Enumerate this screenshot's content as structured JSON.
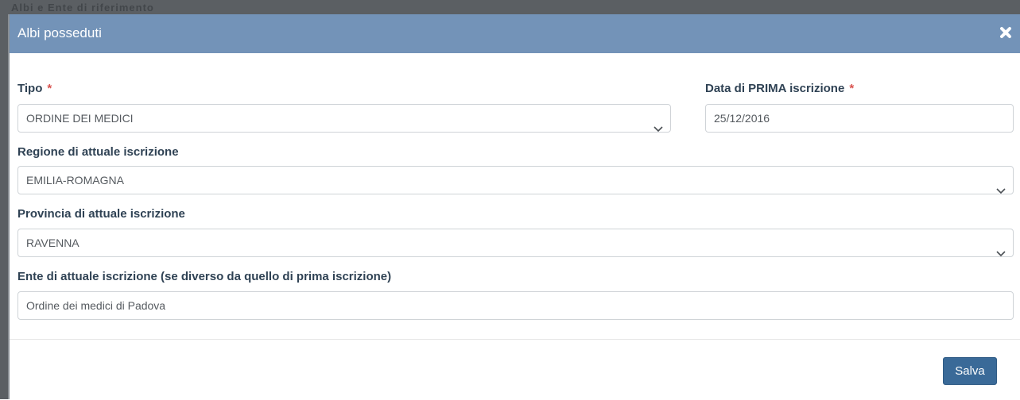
{
  "backdrop": {
    "text": "Albi e Ente di riferimento"
  },
  "modal": {
    "title": "Albi posseduti",
    "close_icon": "close-icon"
  },
  "form": {
    "tipo": {
      "label": "Tipo",
      "required_mark": "*",
      "value": "ORDINE DEI MEDICI"
    },
    "data_prima_iscrizione": {
      "label": "Data di PRIMA iscrizione",
      "required_mark": "*",
      "value": "25/12/2016"
    },
    "regione": {
      "label": "Regione di attuale iscrizione",
      "value": "EMILIA-ROMAGNA"
    },
    "provincia": {
      "label": "Provincia di attuale iscrizione",
      "value": "RAVENNA"
    },
    "ente": {
      "label": "Ente di attuale iscrizione (se diverso da quello di prima iscrizione)",
      "value": "Ordine dei medici di Padova"
    }
  },
  "footer": {
    "save_label": "Salva"
  },
  "colors": {
    "header_bg": "#7393b8",
    "button_bg": "#3a6a98",
    "required": "#d9534f"
  }
}
